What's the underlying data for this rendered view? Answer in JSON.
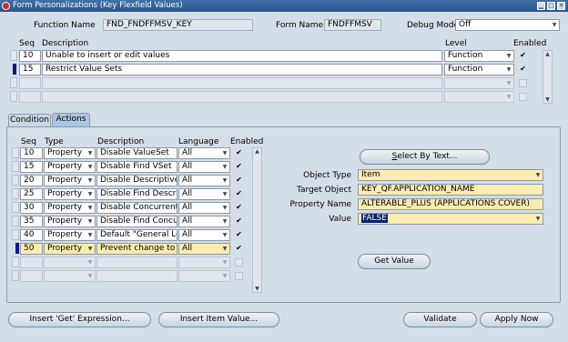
{
  "window": {
    "title": "Form Personalizations (Key Flexfield Values)"
  },
  "header": {
    "function_name_label": "Function Name",
    "function_name": "FND_FNDFFMSV_KEY",
    "form_name_label": "Form Name",
    "form_name": "FNDFFMSV",
    "debug_mode_label": "Debug Mode",
    "debug_mode": "Off"
  },
  "rules": {
    "col_seq": "Seq",
    "col_description": "Description",
    "col_level": "Level",
    "col_enabled": "Enabled",
    "rows": [
      {
        "seq": "10",
        "description": "Unable to insert or edit values",
        "level": "Function",
        "enabled": true
      },
      {
        "seq": "15",
        "description": "Restrict Value Sets",
        "level": "Function",
        "enabled": true
      },
      {
        "seq": "",
        "description": "",
        "level": "",
        "enabled": false
      },
      {
        "seq": "",
        "description": "",
        "level": "",
        "enabled": false
      }
    ]
  },
  "tabs": {
    "condition": "Condition",
    "actions": "Actions"
  },
  "actions": {
    "col_seq": "Seq",
    "col_type": "Type",
    "col_description": "Description",
    "col_language": "Language",
    "col_enabled": "Enabled",
    "rows": [
      {
        "seq": "10",
        "type": "Property",
        "description": "Disable ValueSet",
        "language": "All",
        "enabled": true
      },
      {
        "seq": "15",
        "type": "Property",
        "description": "Disable Find VSet",
        "language": "All",
        "enabled": true
      },
      {
        "seq": "20",
        "type": "Property",
        "description": "Disable Descriptive",
        "language": "All",
        "enabled": true
      },
      {
        "seq": "25",
        "type": "Property",
        "description": "Disable Find Descripti",
        "language": "All",
        "enabled": true
      },
      {
        "seq": "30",
        "type": "Property",
        "description": "Disable Concurrent",
        "language": "All",
        "enabled": true
      },
      {
        "seq": "35",
        "type": "Property",
        "description": "Disable Find Concurre",
        "language": "All",
        "enabled": true
      },
      {
        "seq": "40",
        "type": "Property",
        "description": "Default \"General Ledge",
        "language": "All",
        "enabled": true
      },
      {
        "seq": "50",
        "type": "Property",
        "description": "Prevent change to App",
        "language": "All",
        "enabled": true
      },
      {
        "seq": "",
        "type": "",
        "description": "",
        "language": "",
        "enabled": false
      },
      {
        "seq": "",
        "type": "",
        "description": "",
        "language": "",
        "enabled": false
      }
    ]
  },
  "details": {
    "select_by_text": "Select By Text...",
    "object_type_label": "Object Type",
    "object_type": "Item",
    "target_object_label": "Target Object",
    "target_object": "KEY_QF.APPLICATION_NAME",
    "property_name_label": "Property Name",
    "property_name": "ALTERABLE_PLUS (APPLICATIONS COVER)",
    "value_label": "Value",
    "value": "FALSE",
    "get_value": "Get Value"
  },
  "footer": {
    "insert_get_expression": "Insert 'Get' Expression...",
    "insert_item_value": "Insert Item Value...",
    "validate": "Validate",
    "apply_now": "Apply Now"
  },
  "colors": {
    "titlebar": "#2f5f98",
    "background": "#d4dee8",
    "required_field": "#fdecb0",
    "selection": "#0a246a"
  }
}
